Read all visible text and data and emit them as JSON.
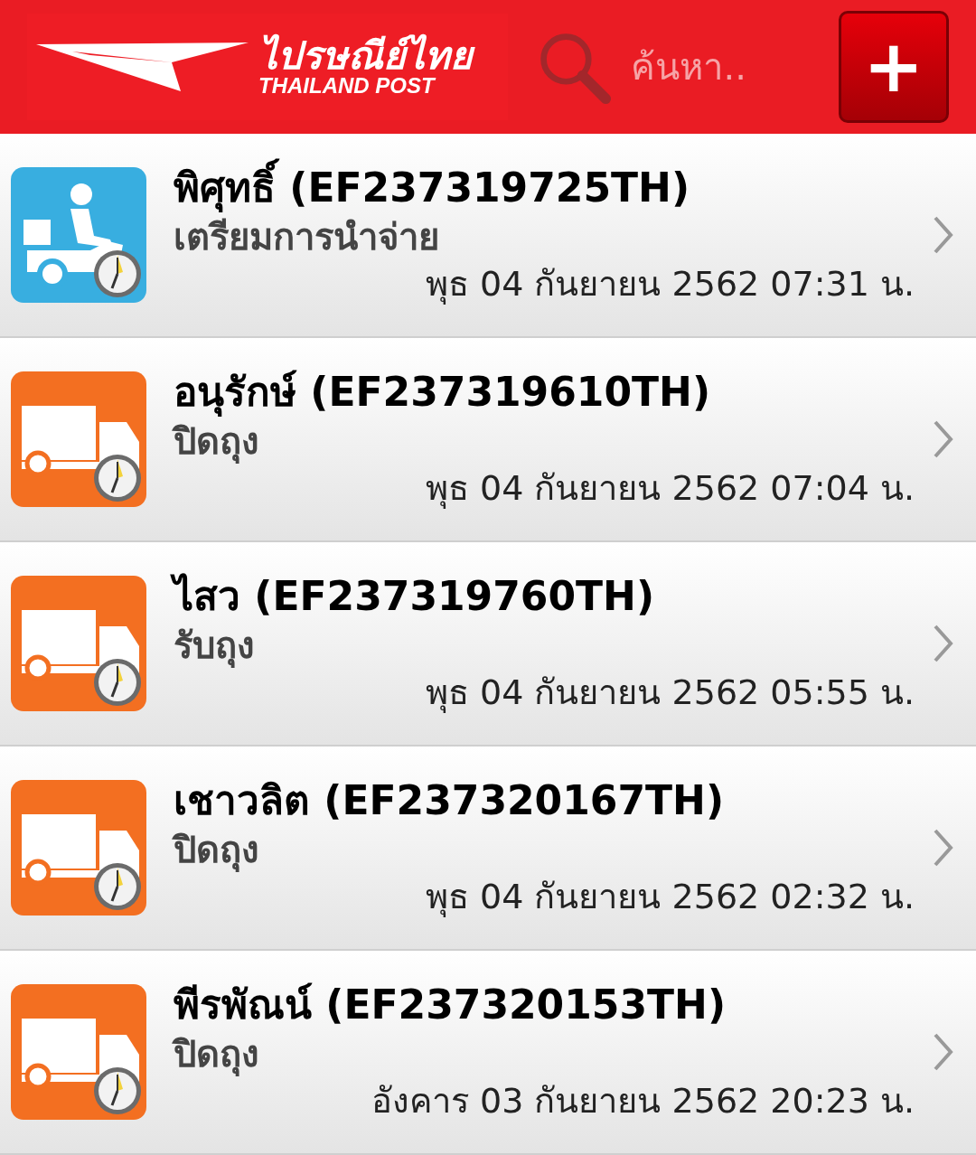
{
  "header": {
    "logo_thai": "ไปรษณีย์ไทย",
    "logo_english": "THAILAND POST",
    "search": {
      "placeholder": "ค้นหา.."
    },
    "add_button": "+"
  },
  "items": [
    {
      "kind": "delivery",
      "title": "พิศุทธิ์ (EF237319725TH)",
      "status": "เตรียมการนำจ่าย",
      "time": "พุธ 04 กันยายน 2562 07:31 น."
    },
    {
      "kind": "transit",
      "title": "อนุรักษ์ (EF237319610TH)",
      "status": "ปิดถุง",
      "time": "พุธ 04 กันยายน 2562 07:04 น."
    },
    {
      "kind": "transit",
      "title": "ไสว (EF237319760TH)",
      "status": "รับถุง",
      "time": "พุธ 04 กันยายน 2562 05:55 น."
    },
    {
      "kind": "transit",
      "title": "เชาวลิต (EF237320167TH)",
      "status": "ปิดถุง",
      "time": "พุธ 04 กันยายน 2562 02:32 น."
    },
    {
      "kind": "transit",
      "title": "พีรพัณน์ (EF237320153TH)",
      "status": "ปิดถุง",
      "time": "อังคาร 03 กันยายน 2562 20:23 น."
    }
  ]
}
